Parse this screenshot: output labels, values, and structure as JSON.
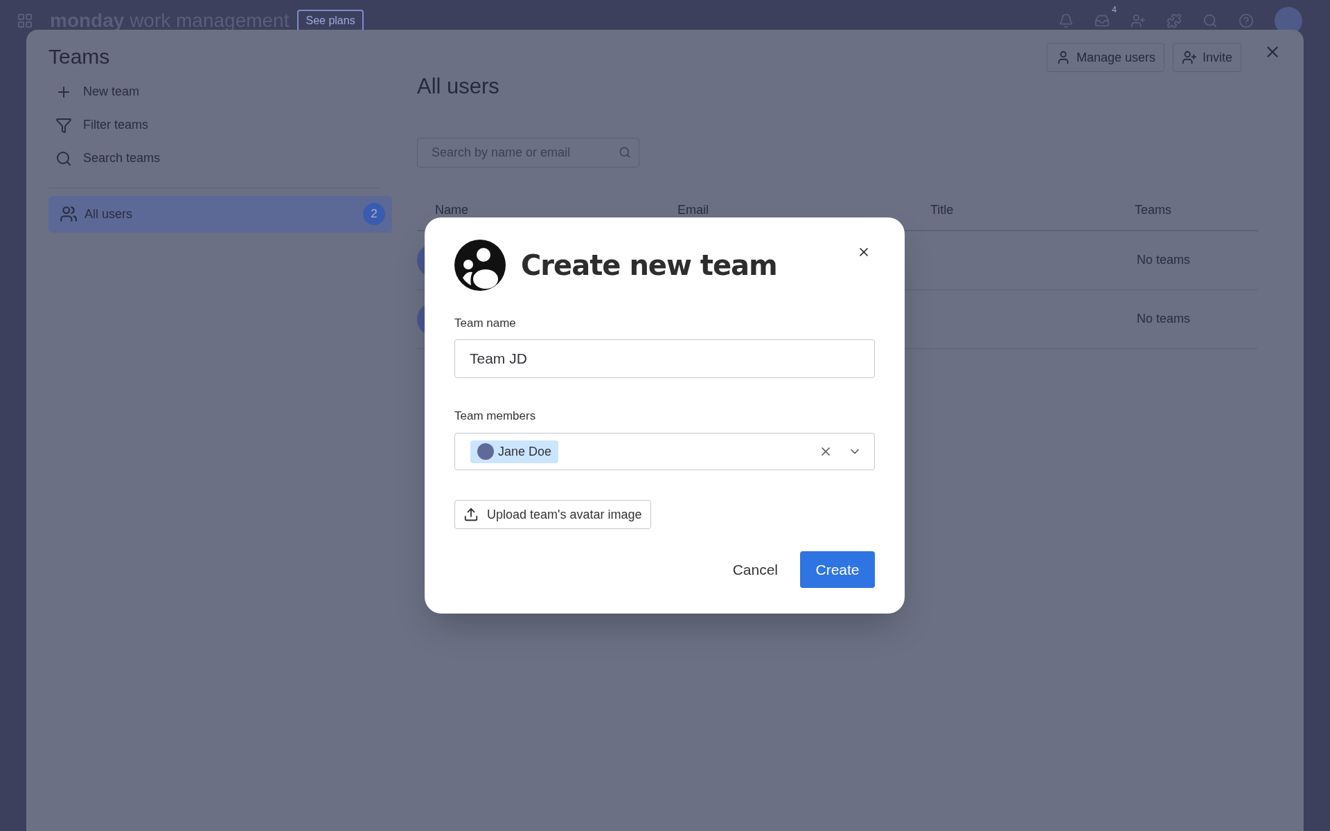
{
  "top_bar": {
    "logo_bold": "monday",
    "logo_rest": "work management",
    "plan_button": "See plans",
    "inbox_badge": "4"
  },
  "teams_panel": {
    "title": "Teams",
    "actions": [
      {
        "kind": "new",
        "label": "New team"
      },
      {
        "kind": "filter",
        "label": "Filter teams"
      },
      {
        "kind": "search",
        "label": "Search teams"
      }
    ],
    "nav": [
      {
        "label": "All users",
        "count": "2",
        "selected": true
      }
    ],
    "header_buttons": [
      {
        "kind": "manage",
        "label": "Manage users"
      },
      {
        "kind": "invite",
        "label": "Invite"
      }
    ]
  },
  "users": {
    "title": "All users",
    "search": {
      "placeholder": "Search by name or email"
    },
    "columns": [
      "Name",
      "Email",
      "Title",
      "Teams"
    ],
    "rows": [
      {
        "teams": "No teams"
      },
      {
        "teams": "No teams"
      }
    ]
  },
  "dialog": {
    "title": "Create new team",
    "team_name_label": "Team name",
    "team_name_value": "Team JD",
    "members_label": "Team members",
    "members": [
      {
        "name": "Jane Doe"
      }
    ],
    "upload_button": "Upload team's avatar image",
    "cancel_button": "Cancel",
    "create_button": "Create"
  }
}
